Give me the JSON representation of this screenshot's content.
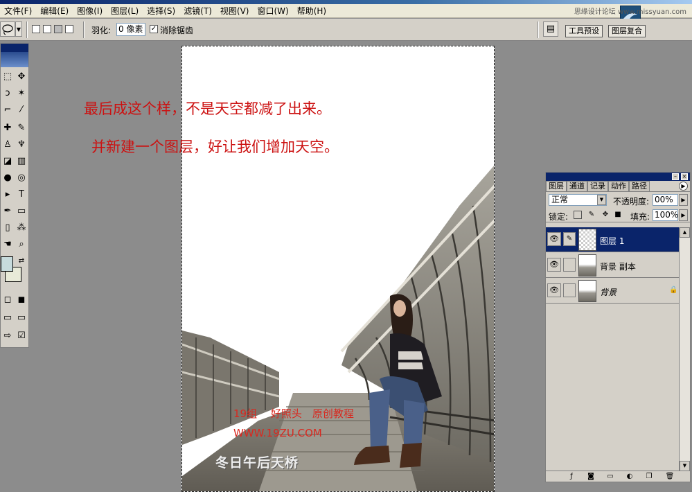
{
  "menubar": {
    "items": [
      "文件(F)",
      "编辑(E)",
      "图像(I)",
      "图层(L)",
      "选择(S)",
      "滤镜(T)",
      "视图(V)",
      "窗口(W)",
      "帮助(H)"
    ],
    "watermark": "思缘设计论坛 www.missyuan.com"
  },
  "options": {
    "feather_label": "羽化:",
    "feather_value": "0 像素",
    "antialias_checked": "✓",
    "antialias_label": "消除锯齿",
    "well_tabs": [
      "工具预设",
      "图层复合"
    ]
  },
  "canvas": {
    "caption_1": "最后成这个样，不是天空都减了出来。",
    "caption_2": "并新建一个图层，好让我们增加天空。",
    "group_line": "19组　 好照头　原创教程",
    "url_line": "WWW.19ZU.COM",
    "signature": "冬日午后天桥"
  },
  "layers_panel": {
    "tabs": [
      "图层",
      "通道",
      "记录",
      "动作",
      "路径"
    ],
    "menu_icon": "▶",
    "blend_mode": "正常",
    "opacity_label": "不透明度:",
    "opacity_value": "00%",
    "lock_label": "锁定:",
    "fill_label": "填充:",
    "fill_value": "100%",
    "layers": [
      {
        "name": "图层 1",
        "selected": true,
        "thumbnail": "transparent"
      },
      {
        "name": "背景 副本",
        "selected": false,
        "thumbnail": "photo"
      },
      {
        "name": "背景",
        "selected": false,
        "thumbnail": "photo",
        "italic": true,
        "locked": true
      }
    ]
  },
  "colors": {
    "caption_red": "#cc1111",
    "selection_blue": "#0a246a",
    "panel_gray": "#d4d0c8"
  }
}
